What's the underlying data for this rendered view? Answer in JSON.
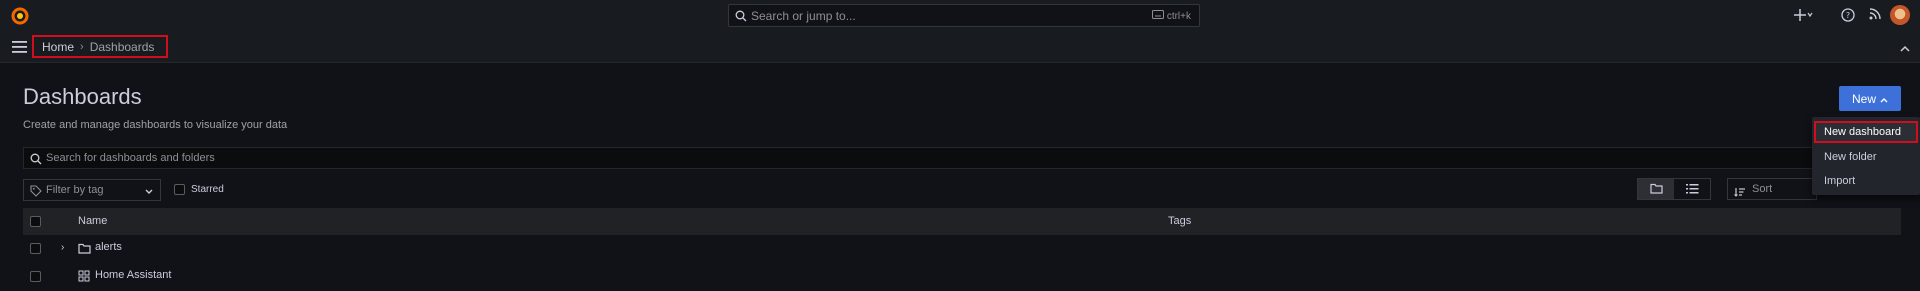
{
  "topbar": {
    "search_placeholder": "Search or jump to...",
    "search_shortcut": "ctrl+k"
  },
  "breadcrumb": {
    "home": "Home",
    "current": "Dashboards"
  },
  "page": {
    "title": "Dashboards",
    "subtitle": "Create and manage dashboards to visualize your data",
    "new_button": "New"
  },
  "new_menu": {
    "items": [
      "New dashboard",
      "New folder",
      "Import"
    ]
  },
  "filters": {
    "search_placeholder": "Search for dashboards and folders",
    "tag_placeholder": "Filter by tag",
    "starred_label": "Starred",
    "sort_placeholder": "Sort"
  },
  "table": {
    "headers": {
      "name": "Name",
      "tags": "Tags"
    },
    "rows": [
      {
        "type": "folder",
        "name": "alerts"
      },
      {
        "type": "dashboard",
        "name": "Home Assistant"
      }
    ]
  },
  "colors": {
    "accent": "#3d71d9",
    "highlight": "#d10e1e",
    "background": "#111217"
  }
}
